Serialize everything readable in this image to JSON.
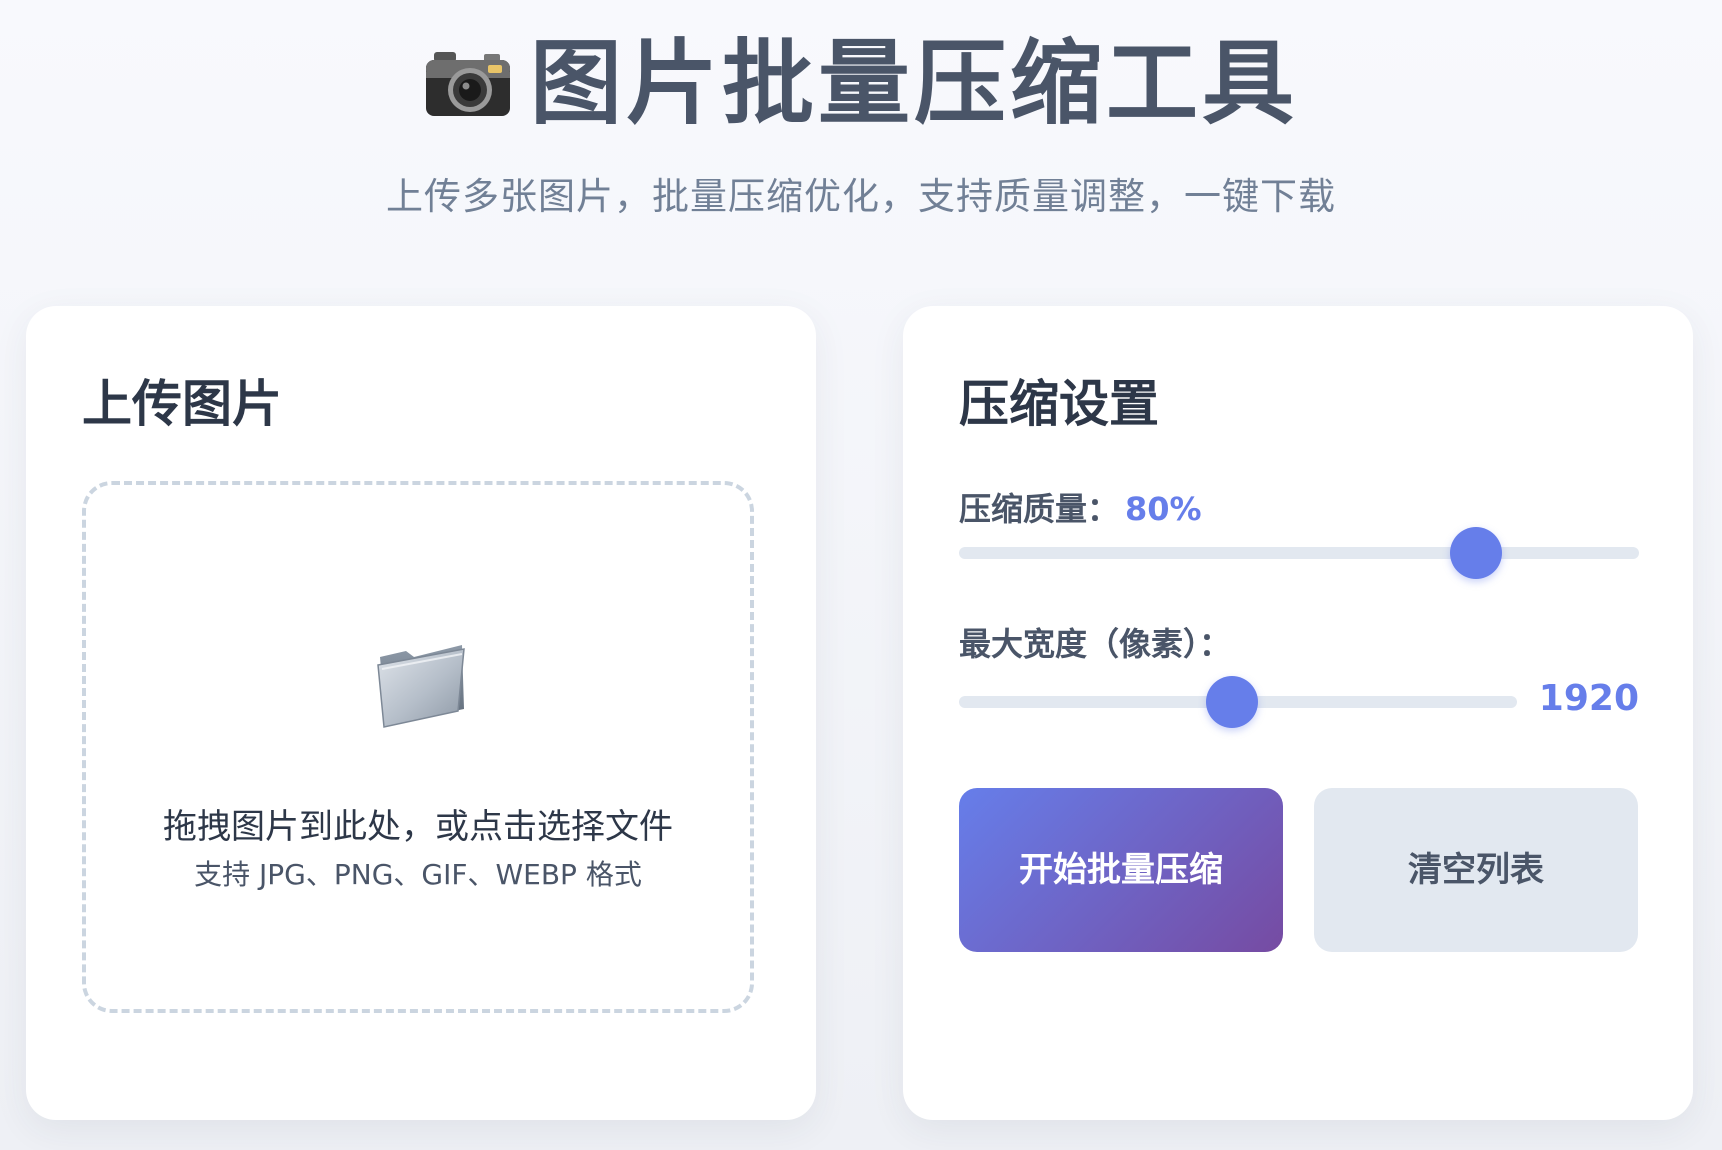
{
  "header": {
    "title": "图片批量压缩工具",
    "subtitle": "上传多张图片，批量压缩优化，支持质量调整，一键下载",
    "icon": "camera-icon"
  },
  "upload": {
    "title": "上传图片",
    "icon": "folder-icon",
    "drop_text": "拖拽图片到此处，或点击选择文件",
    "hint": "支持 JPG、PNG、GIF、WEBP 格式"
  },
  "settings": {
    "title": "压缩设置",
    "quality": {
      "label": "压缩质量：",
      "value": "80%",
      "level": 0.76
    },
    "max_width": {
      "label": "最大宽度（像素）：",
      "value": "1920",
      "level": 0.49
    },
    "start_button": "开始批量压缩",
    "clear_button": "清空列表"
  },
  "colors": {
    "accent": "#667eea",
    "gradient_end": "#764ba2",
    "title": "#4a5568",
    "border": "#cbd5e0"
  }
}
